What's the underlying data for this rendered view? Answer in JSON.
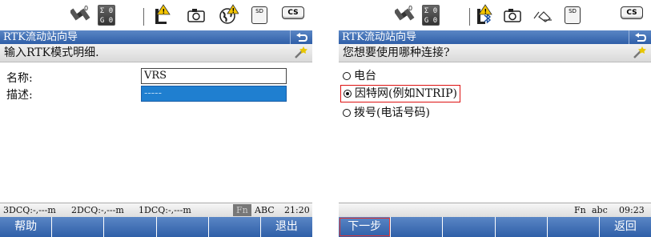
{
  "left": {
    "status": {
      "sat_top": "Σ 0",
      "sat_bottom": "G 0",
      "cs_label": "CS",
      "sd_label": "SD"
    },
    "title": "RTK流动站向导",
    "instruction": "输入RTK模式明细.",
    "fields": [
      {
        "label": "名称:",
        "value": "VRS"
      },
      {
        "label": "描述:",
        "value": "-----"
      }
    ],
    "info": {
      "dcq3": "3DCQ:-,---m",
      "dcq2": "2DCQ:-,---m",
      "dcq1": "1DCQ:-,---m",
      "fn": "Fn",
      "mode": "ABC",
      "time": "21:20"
    },
    "softkeys": [
      "帮助",
      "",
      "",
      "",
      "",
      "退出"
    ]
  },
  "right": {
    "status": {
      "sat_top": "Σ 0",
      "sat_bottom": "G 0",
      "cs_label": "CS",
      "sd_label": "SD"
    },
    "title": "RTK流动站向导",
    "instruction": "您想要使用哪种连接?",
    "options": [
      {
        "label": "电台",
        "checked": false
      },
      {
        "label": "因特网(例如NTRIP)",
        "checked": true
      },
      {
        "label": "拨号(电话号码)",
        "checked": false
      }
    ],
    "info": {
      "fn": "Fn",
      "mode": "abc",
      "time": "09:23"
    },
    "softkeys": [
      "下一步",
      "",
      "",
      "",
      "",
      "返回"
    ]
  },
  "colors": {
    "title_blue": "#2f5fa8",
    "selection_blue": "#1f7fd0",
    "highlight_red": "#dd1111"
  }
}
